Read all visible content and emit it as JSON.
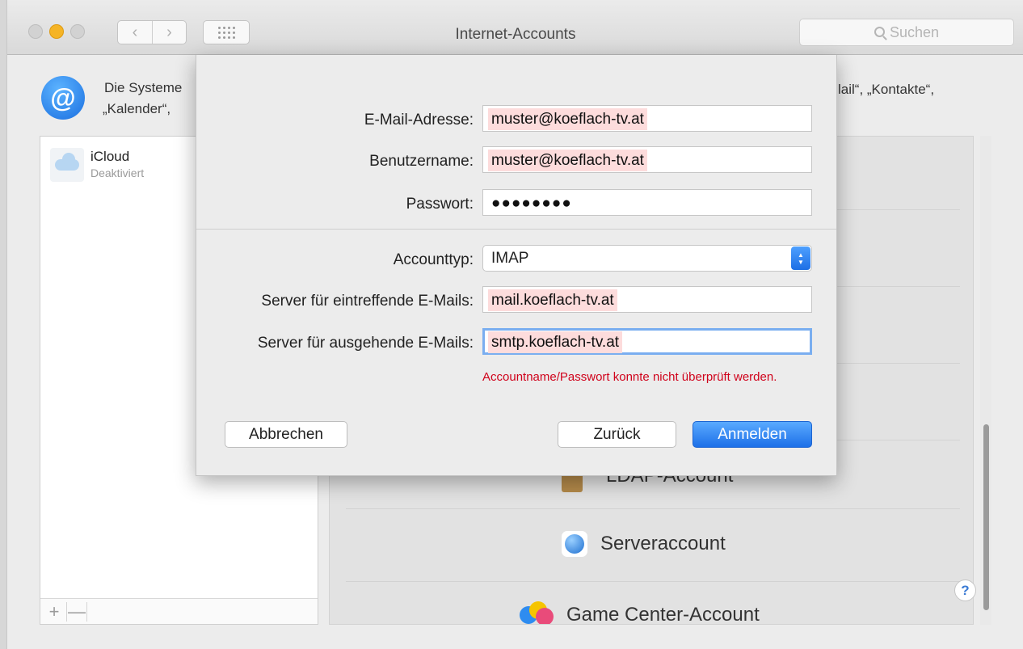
{
  "window": {
    "title": "Internet-Accounts",
    "search_placeholder": "Suchen"
  },
  "header": {
    "description_line1": "Die Systeme",
    "description_line2": "„Kalender“,",
    "description_right": "lail“, „Kontakte“,"
  },
  "sidebar": {
    "accounts": [
      {
        "name": "iCloud",
        "status": "Deaktiviert",
        "icon": "cloud-icon"
      }
    ],
    "add_label": "+",
    "remove_label": "—"
  },
  "providers": {
    "ldap_label": "LDAP-Account",
    "server_label": "Serveraccount",
    "gamecenter_label": "Game Center-Account"
  },
  "sheet": {
    "email_label": "E-Mail-Adresse:",
    "email_value": "muster@koeflach-tv.at",
    "username_label": "Benutzername:",
    "username_value": "muster@koeflach-tv.at",
    "password_label": "Passwort:",
    "password_value": "●●●●●●●●",
    "account_type_label": "Accounttyp:",
    "account_type_value": "IMAP",
    "incoming_label": "Server für eintreffende E-Mails:",
    "incoming_value": "mail.koeflach-tv.at",
    "outgoing_label": "Server für ausgehende E-Mails:",
    "outgoing_value": "smtp.koeflach-tv.at",
    "error_message": "Accountname/Passwort konnte nicht überprüft werden.",
    "cancel_label": "Abbrechen",
    "back_label": "Zurück",
    "signin_label": "Anmelden"
  },
  "help_label": "?",
  "colors": {
    "accent": "#1d70e8",
    "error": "#d0021b",
    "autofill_highlight": "#fddcdc",
    "minimize_button": "#f5b426"
  }
}
